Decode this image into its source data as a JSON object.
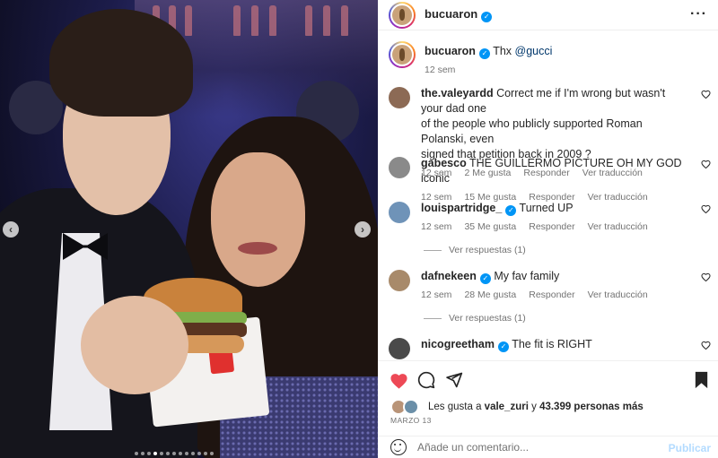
{
  "post": {
    "username": "bucuaron",
    "caption_text": "Thx",
    "caption_mention": "@gucci",
    "caption_time": "12 sem"
  },
  "icons": {
    "more": "more-options-icon",
    "verified": "verified-badge-icon",
    "like": "heart-filled-icon",
    "comment": "speech-bubble-icon",
    "share": "paper-plane-icon",
    "save": "bookmark-filled-icon",
    "emoji": "emoji-smile-icon"
  },
  "colors": {
    "like_red": "#ed4956",
    "verified_blue": "#0095f6",
    "publish_disabled": "#b3dbff"
  },
  "comments": [
    {
      "username": "the.valeyardd",
      "verified": false,
      "text_lines": [
        "Correct me if I'm wrong but wasn't your dad one",
        "of the people who publicly supported Roman Polanski, even",
        "signed that petition back in 2009 ?"
      ],
      "time": "12 sem",
      "likes": "2 Me gusta",
      "reply": "Responder",
      "translate": "Ver traducción",
      "view_replies": ""
    },
    {
      "username": "gabesco",
      "verified": false,
      "text_lines": [
        "THE GUILLERMO PICTURE OH MY GOD iconic"
      ],
      "time": "12 sem",
      "likes": "15 Me gusta",
      "reply": "Responder",
      "translate": "Ver traducción",
      "view_replies": ""
    },
    {
      "username": "louispartridge_",
      "verified": true,
      "text_lines": [
        "Turned UP"
      ],
      "time": "12 sem",
      "likes": "35 Me gusta",
      "reply": "Responder",
      "translate": "Ver traducción",
      "view_replies": "Ver respuestas (1)"
    },
    {
      "username": "dafnekeen",
      "verified": true,
      "text_lines": [
        "My fav family"
      ],
      "time": "12 sem",
      "likes": "28 Me gusta",
      "reply": "Responder",
      "translate": "Ver traducción",
      "view_replies": "Ver respuestas (1)"
    },
    {
      "username": "nicogreetham",
      "verified": true,
      "text_lines": [
        "The fit is RIGHT"
      ],
      "time": "",
      "likes": "",
      "reply": "",
      "translate": "",
      "view_replies": ""
    }
  ],
  "likes_summary": {
    "prefix": "Les gusta a",
    "user": "vale_zuri",
    "connector": "y",
    "count": "43.399 personas más"
  },
  "date": "MARZO 13",
  "add_comment": {
    "placeholder": "Añade un comentario...",
    "publish_label": "Publicar"
  },
  "carousel": {
    "total_slides": 13,
    "active_slide": 4
  }
}
